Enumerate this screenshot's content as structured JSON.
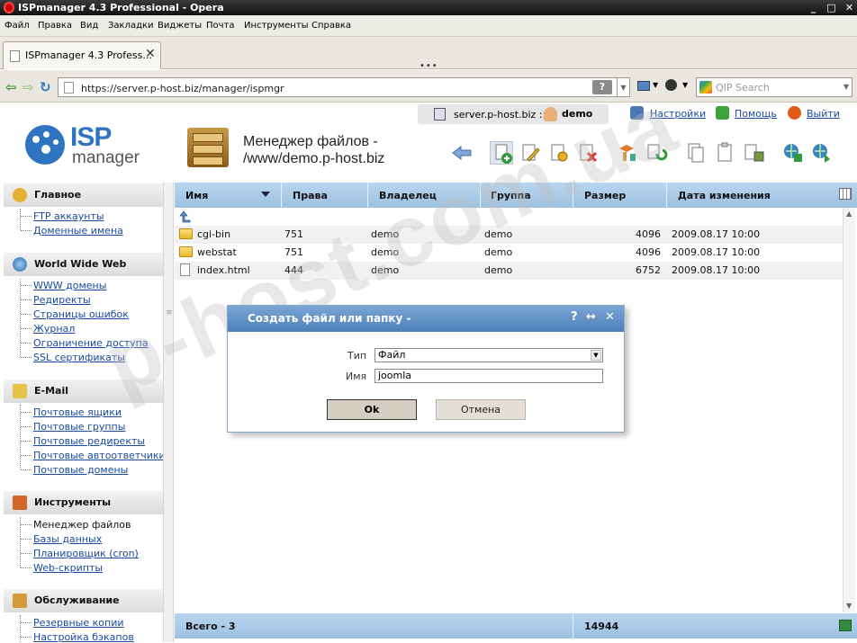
{
  "window": {
    "title": "ISPmanager 4.3 Professional - Opera"
  },
  "menu": [
    "Файл",
    "Правка",
    "Вид",
    "Закладки",
    "Виджеты",
    "Почта",
    "Инструменты",
    "Справка"
  ],
  "tab": {
    "title": "ISPmanager 4.3 Profess..."
  },
  "address": {
    "url": "https://server.p-host.biz/manager/ispmgr",
    "search_placeholder": "QIP Search"
  },
  "header": {
    "logo_top": "ISP",
    "logo_bottom": "manager",
    "server": "server.p-host.biz ::",
    "user": "demo",
    "links": {
      "settings": "Настройки",
      "help": "Помощь",
      "logout": "Выйти"
    },
    "title_line1": "Менеджер файлов -",
    "title_line2": "/www/demo.p-host.biz"
  },
  "sidebar": {
    "sections": [
      {
        "title": "Главное",
        "items": [
          "FTP аккаунты",
          "Доменные имена"
        ]
      },
      {
        "title": "World Wide Web",
        "items": [
          "WWW домены",
          "Редиректы",
          "Страницы ошибок",
          "Журнал",
          "Ограничение доступа",
          "SSL сертификаты"
        ]
      },
      {
        "title": "E-Mail",
        "items": [
          "Почтовые ящики",
          "Почтовые группы",
          "Почтовые редиректы",
          "Почтовые автоответчики",
          "Почтовые домены"
        ]
      },
      {
        "title": "Инструменты",
        "items": [
          "Менеджер файлов",
          "Базы данных",
          "Планировщик (cron)",
          "Web-скрипты"
        ]
      },
      {
        "title": "Обслуживание",
        "items": [
          "Резервные копии",
          "Настройка бэкапов"
        ]
      }
    ]
  },
  "table": {
    "columns": [
      "Имя",
      "Права",
      "Владелец",
      "Группа",
      "Размер",
      "Дата изменения"
    ],
    "rows": [
      {
        "name": "cgi-bin",
        "perm": "751",
        "owner": "demo",
        "group": "demo",
        "size": "4096",
        "date": "2009.08.17 10:00",
        "type": "folder"
      },
      {
        "name": "webstat",
        "perm": "751",
        "owner": "demo",
        "group": "demo",
        "size": "4096",
        "date": "2009.08.17 10:00",
        "type": "folder"
      },
      {
        "name": "index.html",
        "perm": "444",
        "owner": "demo",
        "group": "demo",
        "size": "6752",
        "date": "2009.08.17 10:00",
        "type": "file"
      }
    ],
    "footer": {
      "total": "Всего - 3",
      "size_total": "14944"
    }
  },
  "watermark": "p-host.com.ua",
  "dialog": {
    "title": "Создать файл или папку -",
    "type_label": "Тип",
    "type_value": "Файл",
    "name_label": "Имя",
    "name_value": "joomla",
    "ok": "Ok",
    "cancel": "Отмена"
  }
}
